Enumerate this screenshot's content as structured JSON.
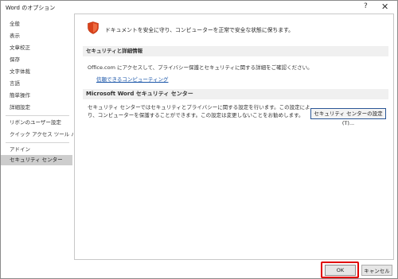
{
  "window": {
    "title": "Word のオプション",
    "help_glyph": "?",
    "close_glyph": "✕"
  },
  "sidebar": {
    "items": [
      {
        "label": "全般"
      },
      {
        "label": "表示"
      },
      {
        "label": "文章校正"
      },
      {
        "label": "保存"
      },
      {
        "label": "文字体裁"
      },
      {
        "label": "言語"
      },
      {
        "label": "簡単操作"
      },
      {
        "label": "詳細設定"
      },
      {
        "label": "リボンのユーザー設定"
      },
      {
        "label": "クイック アクセス ツール バー"
      },
      {
        "label": "アドイン"
      },
      {
        "label": "セキュリティ センター"
      }
    ],
    "selected": "セキュリティ センター"
  },
  "main": {
    "intro_text": "ドキュメントを安全に守り、コンピューターを正常で安全な状態に保ちます。",
    "privacy": {
      "header": "セキュリティと詳細情報",
      "text": "Office.com にアクセスして、プライバシー保護とセキュリティに関する詳細をご確認ください。",
      "link": "信頼できるコンピューティング"
    },
    "trust_center": {
      "header": "Microsoft Word セキュリティ センター",
      "text": "セキュリティ センターではセキュリティとプライバシーに関する設定を行います。この設定により、コンピューターを保護することができます。この設定は変更しないことをお勧めします。",
      "button": "セキュリティ センターの設定(T)..."
    }
  },
  "footer": {
    "ok_label": "OK",
    "cancel_label": "キャンセル"
  },
  "colors": {
    "shield": "#d9421b",
    "link": "#1a55a8",
    "highlight": "#e00000",
    "selected_bg": "#cdcdcd"
  },
  "icons": {
    "shield": "shield-icon"
  }
}
